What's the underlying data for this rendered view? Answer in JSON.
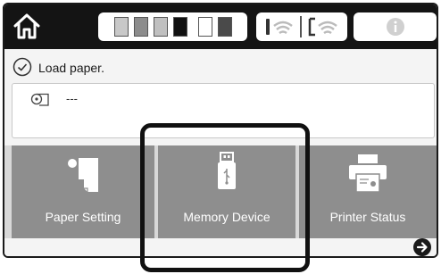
{
  "status": {
    "message": "Load paper."
  },
  "paper": {
    "info": "---"
  },
  "ink": {
    "cartridges": [
      {
        "name": "light-gray",
        "level": 1.0,
        "color": "#c8c8c8"
      },
      {
        "name": "dark-gray",
        "level": 1.0,
        "color": "#8c8c8c"
      },
      {
        "name": "light-gray-2",
        "level": 1.0,
        "color": "#c0c0c0"
      },
      {
        "name": "black",
        "level": 1.0,
        "color": "#111111"
      },
      {
        "name": "empty",
        "level": 0.0,
        "color": "#ffffff"
      },
      {
        "name": "dark",
        "level": 1.0,
        "color": "#4a4a4a"
      }
    ]
  },
  "tiles": [
    {
      "label": "Paper Setting",
      "icon": "paper-setting-icon"
    },
    {
      "label": "Memory Device",
      "icon": "usb-drive-icon"
    },
    {
      "label": "Printer Status",
      "icon": "printer-icon"
    }
  ],
  "icons": {
    "home": "home-icon",
    "wifi": "wifi-icon",
    "wifi_direct": "wifi-direct-icon",
    "info": "info-icon",
    "check": "check-circle-icon",
    "roll": "paper-roll-icon",
    "next": "arrow-right-icon"
  },
  "colors": {
    "topbar": "#141414",
    "tile": "#8e8e8e",
    "highlight": "#111111"
  }
}
